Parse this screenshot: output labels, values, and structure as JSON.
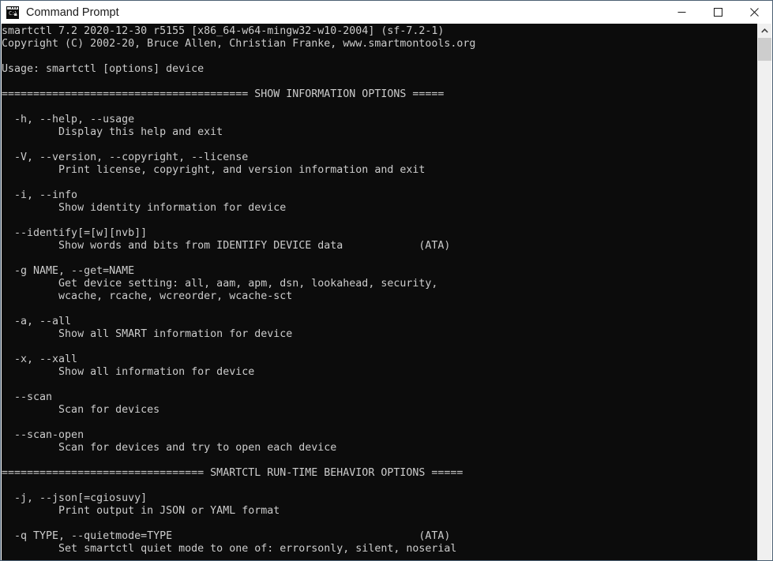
{
  "window": {
    "title": "Command Prompt",
    "icon": "command-prompt-icon",
    "icon_prompt_text": "C:\\",
    "colors": {
      "console_background": "#0c0c0c",
      "console_foreground": "#cccccc",
      "titlebar_background": "#ffffff",
      "titlebar_foreground": "#1a1a1a",
      "window_border": "#4c6073",
      "scrollbar_track": "#f0f0f0",
      "scrollbar_thumb": "#cdcdcd"
    },
    "controls": {
      "minimize_label": "Minimize",
      "maximize_label": "Maximize",
      "close_label": "Close"
    }
  },
  "scrollbar": {
    "up_arrow_label": "Scroll up",
    "thumb_label": "Scroll thumb"
  },
  "console": {
    "lines": [
      "smartctl 7.2 2020-12-30 r5155 [x86_64-w64-mingw32-w10-2004] (sf-7.2-1)",
      "Copyright (C) 2002-20, Bruce Allen, Christian Franke, www.smartmontools.org",
      "",
      "Usage: smartctl [options] device",
      "",
      "======================================= SHOW INFORMATION OPTIONS =====",
      "",
      "  -h, --help, --usage",
      "         Display this help and exit",
      "",
      "  -V, --version, --copyright, --license",
      "         Print license, copyright, and version information and exit",
      "",
      "  -i, --info",
      "         Show identity information for device",
      "",
      "  --identify[=[w][nvb]]",
      "         Show words and bits from IDENTIFY DEVICE data            (ATA)",
      "",
      "  -g NAME, --get=NAME",
      "         Get device setting: all, aam, apm, dsn, lookahead, security,",
      "         wcache, rcache, wcreorder, wcache-sct",
      "",
      "  -a, --all",
      "         Show all SMART information for device",
      "",
      "  -x, --xall",
      "         Show all information for device",
      "",
      "  --scan",
      "         Scan for devices",
      "",
      "  --scan-open",
      "         Scan for devices and try to open each device",
      "",
      "================================ SMARTCTL RUN-TIME BEHAVIOR OPTIONS =====",
      "",
      "  -j, --json[=cgiosuvy]",
      "         Print output in JSON or YAML format",
      "",
      "  -q TYPE, --quietmode=TYPE                                       (ATA)",
      "         Set smartctl quiet mode to one of: errorsonly, silent, noserial"
    ],
    "program": "smartctl",
    "version": "7.2",
    "build_date": "2020-12-30",
    "revision": "r5155",
    "platform": "x86_64-w64-mingw32-w10-2004",
    "package": "sf-7.2-1",
    "copyright": "Copyright (C) 2002-20, Bruce Allen, Christian Franke, www.smartmontools.org",
    "usage": "Usage: smartctl [options] device",
    "sections": [
      {
        "heading": "SHOW INFORMATION OPTIONS",
        "options": [
          {
            "flags": "-h, --help, --usage",
            "description": "Display this help and exit",
            "note": ""
          },
          {
            "flags": "-V, --version, --copyright, --license",
            "description": "Print license, copyright, and version information and exit",
            "note": ""
          },
          {
            "flags": "-i, --info",
            "description": "Show identity information for device",
            "note": ""
          },
          {
            "flags": "--identify[=[w][nvb]]",
            "description": "Show words and bits from IDENTIFY DEVICE data",
            "note": "(ATA)"
          },
          {
            "flags": "-g NAME, --get=NAME",
            "description": "Get device setting: all, aam, apm, dsn, lookahead, security, wcache, rcache, wcreorder, wcache-sct",
            "note": ""
          },
          {
            "flags": "-a, --all",
            "description": "Show all SMART information for device",
            "note": ""
          },
          {
            "flags": "-x, --xall",
            "description": "Show all information for device",
            "note": ""
          },
          {
            "flags": "--scan",
            "description": "Scan for devices",
            "note": ""
          },
          {
            "flags": "--scan-open",
            "description": "Scan for devices and try to open each device",
            "note": ""
          }
        ]
      },
      {
        "heading": "SMARTCTL RUN-TIME BEHAVIOR OPTIONS",
        "options": [
          {
            "flags": "-j, --json[=cgiosuvy]",
            "description": "Print output in JSON or YAML format",
            "note": ""
          },
          {
            "flags": "-q TYPE, --quietmode=TYPE",
            "description": "Set smartctl quiet mode to one of: errorsonly, silent, noserial",
            "note": "(ATA)"
          }
        ]
      }
    ]
  }
}
